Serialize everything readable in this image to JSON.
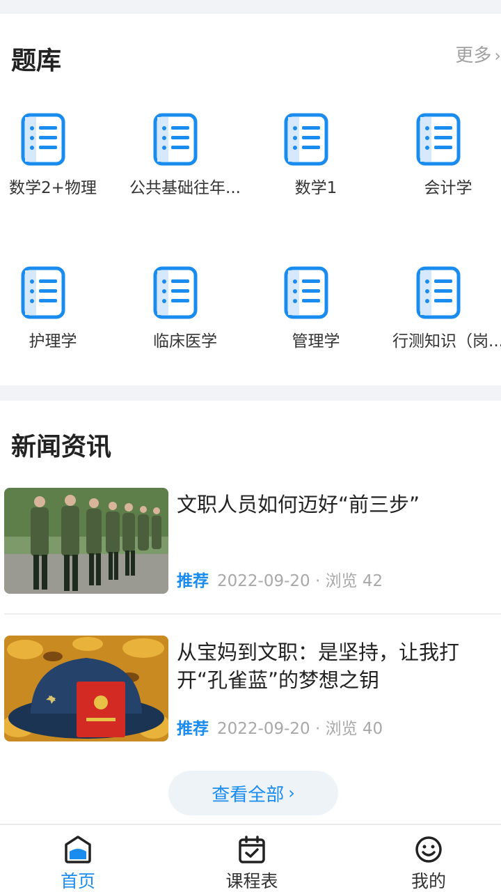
{
  "question_bank": {
    "title": "题库",
    "more_label": "更多",
    "items": [
      {
        "label": "数学2+物理"
      },
      {
        "label": "公共基础往年..."
      },
      {
        "label": "数学1"
      },
      {
        "label": "会计学"
      },
      {
        "label": "护理学"
      },
      {
        "label": "临床医学"
      },
      {
        "label": "管理学"
      },
      {
        "label": "行测知识（岗..."
      }
    ]
  },
  "news": {
    "title": "新闻资讯",
    "items": [
      {
        "title": "文职人员如何迈好“前三步”",
        "tag": "推荐",
        "meta": "2022-09-20 · 浏览 42"
      },
      {
        "title": "从宝妈到文职：是坚持，让我打开“孔雀蓝”的梦想之钥",
        "tag": "推荐",
        "meta": "2022-09-20 · 浏览 40"
      }
    ],
    "view_all_label": "查看全部"
  },
  "tabbar": {
    "items": [
      {
        "label": "首页",
        "icon": "home-icon",
        "active": true
      },
      {
        "label": "课程表",
        "icon": "calendar-check-icon",
        "active": false
      },
      {
        "label": "我的",
        "icon": "smiley-icon",
        "active": false
      }
    ]
  },
  "colors": {
    "accent": "#1a8cf0",
    "icon_light": "#d6e8fb",
    "separator": "#f1f3f6"
  }
}
